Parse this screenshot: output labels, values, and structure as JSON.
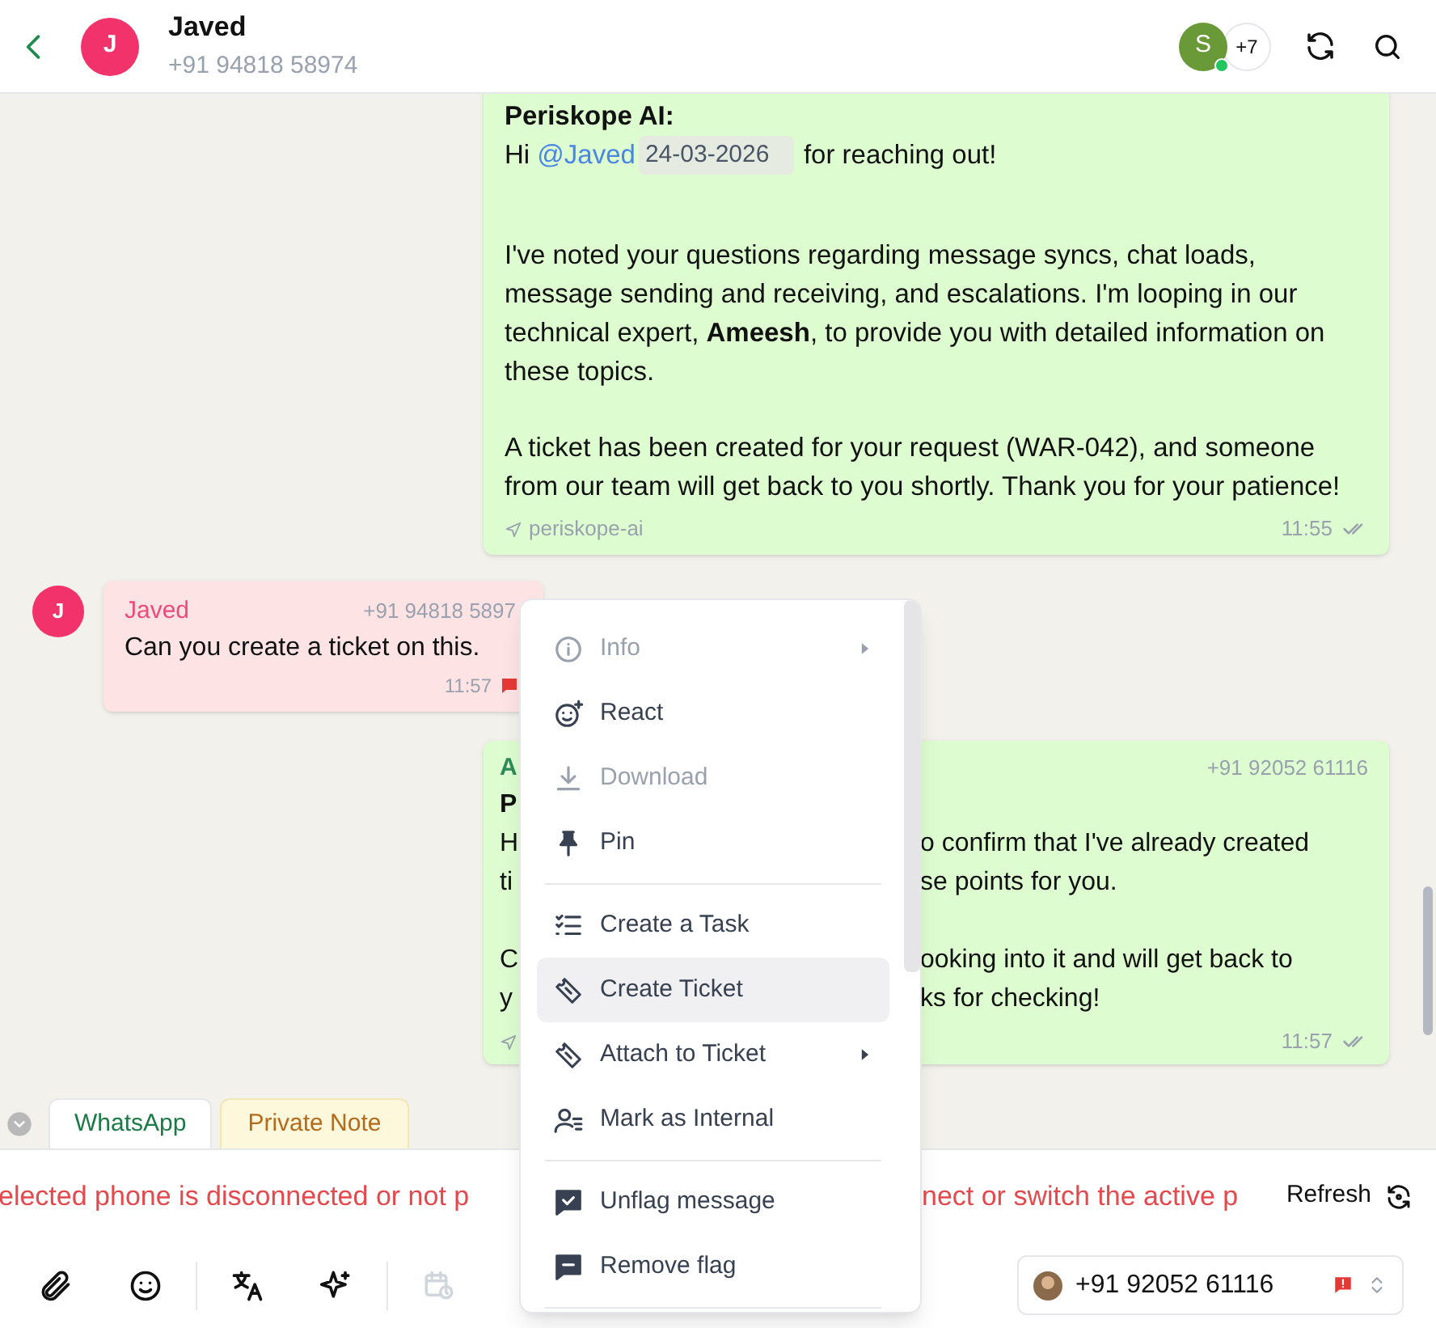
{
  "header": {
    "avatar_initial": "J",
    "name": "Javed",
    "phone": "+91 94818 58974",
    "member_initial": "S",
    "member_online": true,
    "more_members": "+7"
  },
  "messages": [
    {
      "kind": "ai_reply",
      "sender": "Periskope AI:",
      "greeting": "Hi ",
      "mention": "@Javed",
      "date_chip": "24-03-2026",
      "greeting_rest": "for reaching out!",
      "paragraphs": [
        "I've noted your questions regarding message syncs, chat loads, message sending and receiving, and escalations. I'm looping in our technical expert, **Ameesh**, to provide you with detailed information on these topics.",
        "A ticket has been created for your request (WAR-042), and someone from our team will get back to you shortly. Thank you for your patience!"
      ],
      "via": "periskope-ai",
      "time": "11:55",
      "read": true
    },
    {
      "kind": "incoming",
      "avatar_initial": "J",
      "sender": "Javed",
      "phone": "+91 94818 5897",
      "text": "Can you create a ticket on this.",
      "time": "11:57",
      "flagged": true
    },
    {
      "kind": "covered_reply",
      "sender": "A",
      "phone": "+91 92052 61116",
      "lines": [
        {
          "left": "P"
        },
        {
          "left": "H",
          "right": "o confirm that I've already created"
        },
        {
          "left": "ti",
          "right": "se points for you."
        },
        {
          "new_paragraph": true,
          "left": "C",
          "right": "ooking into it and will get back to"
        },
        {
          "left": "y",
          "right": "ks for checking!"
        }
      ],
      "time": "11:57",
      "read": true
    }
  ],
  "tabs": [
    {
      "label": "WhatsApp",
      "selected": true
    },
    {
      "label": "Private Note",
      "selected": false
    }
  ],
  "banner": {
    "left": "elected phone is disconnected or not p",
    "right": "nect or switch the active p",
    "action": "Refresh"
  },
  "sender_phone": {
    "number": "+91 92052 61116",
    "flagged": true
  },
  "menu": {
    "groups": [
      [
        {
          "label": "Info",
          "kind": "info",
          "disabled": true,
          "submenu": true,
          "selected": false
        },
        {
          "label": "React",
          "kind": "react",
          "disabled": false,
          "submenu": false,
          "selected": false
        },
        {
          "label": "Download",
          "kind": "download",
          "disabled": true,
          "submenu": false,
          "selected": false
        },
        {
          "label": "Pin",
          "kind": "pin",
          "disabled": false,
          "submenu": false,
          "selected": false
        }
      ],
      [
        {
          "label": "Create a Task",
          "kind": "task",
          "disabled": false,
          "submenu": false,
          "selected": false
        },
        {
          "label": "Create Ticket",
          "kind": "ticket",
          "disabled": false,
          "submenu": false,
          "selected": true
        },
        {
          "label": "Attach to Ticket",
          "kind": "ticket",
          "disabled": false,
          "submenu": true,
          "selected": false
        },
        {
          "label": "Mark as Internal",
          "kind": "internal",
          "disabled": false,
          "submenu": false,
          "selected": false
        }
      ],
      [
        {
          "label": "Unflag message",
          "kind": "unflag",
          "disabled": false,
          "submenu": false,
          "selected": false
        },
        {
          "label": "Remove flag",
          "kind": "flag",
          "disabled": false,
          "submenu": false,
          "selected": false
        }
      ]
    ]
  }
}
